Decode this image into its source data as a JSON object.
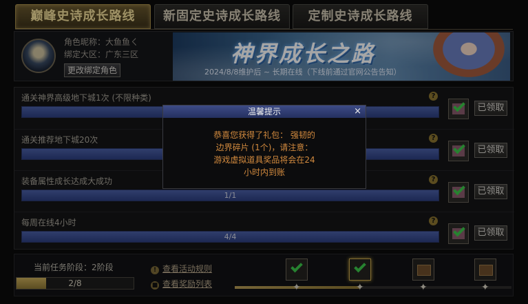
{
  "tabs": [
    {
      "label": "巅峰史诗成长路线",
      "active": true
    },
    {
      "label": "新固定史诗成长路线",
      "active": false
    },
    {
      "label": "定制史诗成长路线",
      "active": false
    }
  ],
  "profile": {
    "name_label": "角色昵称：大鱼鱼ㄑ",
    "zone_label": "绑定大区：广东三区",
    "rebind_button": "更改绑定角色"
  },
  "banner": {
    "title": "神界成长之路",
    "subtitle": "2024/8/8维护后 ~ 长期在线（下线前通过官网公告告知）"
  },
  "tasks": [
    {
      "title": "通关神界高级地下城1次 (不限种类)",
      "progress_text": "",
      "progress": 1.0,
      "claim_label": "已领取"
    },
    {
      "title": "通关推荐地下城20次",
      "progress_text": "",
      "progress": 1.0,
      "claim_label": "已领取"
    },
    {
      "title": "装备属性成长达成大成功",
      "progress_text": "1/1",
      "progress": 1.0,
      "claim_label": "已领取"
    },
    {
      "title": "每周在线4小时",
      "progress_text": "4/4",
      "progress": 1.0,
      "claim_label": "已领取"
    }
  ],
  "footer": {
    "stage_label": "当前任务阶段：2阶段",
    "stage_progress_text": "2/8",
    "stage_progress": 0.25,
    "rules_link": "查看活动规则",
    "rewards_link": "查看奖励列表",
    "milestones": [
      {
        "state": "claimed"
      },
      {
        "state": "claimed"
      },
      {
        "state": "locked"
      },
      {
        "state": "locked"
      }
    ],
    "track_progress": 0.45
  },
  "dialog": {
    "title": "温馨提示",
    "close": "×",
    "line1": "恭喜您获得了礼包： 强韧的",
    "line2": "边界碎片 (1个)，请注意：",
    "line3": "游戏虚拟道具奖品将会在24",
    "line4": "小时内到账"
  },
  "icons": {
    "help": "question-icon",
    "check": "check-icon",
    "gift": "gift-icon",
    "close": "close-icon"
  },
  "colors": {
    "gold_accent": "#c9a84a",
    "bar_blue": "#2d3f80",
    "dialog_text": "#d28a3e",
    "check_green": "#3cc84a"
  }
}
